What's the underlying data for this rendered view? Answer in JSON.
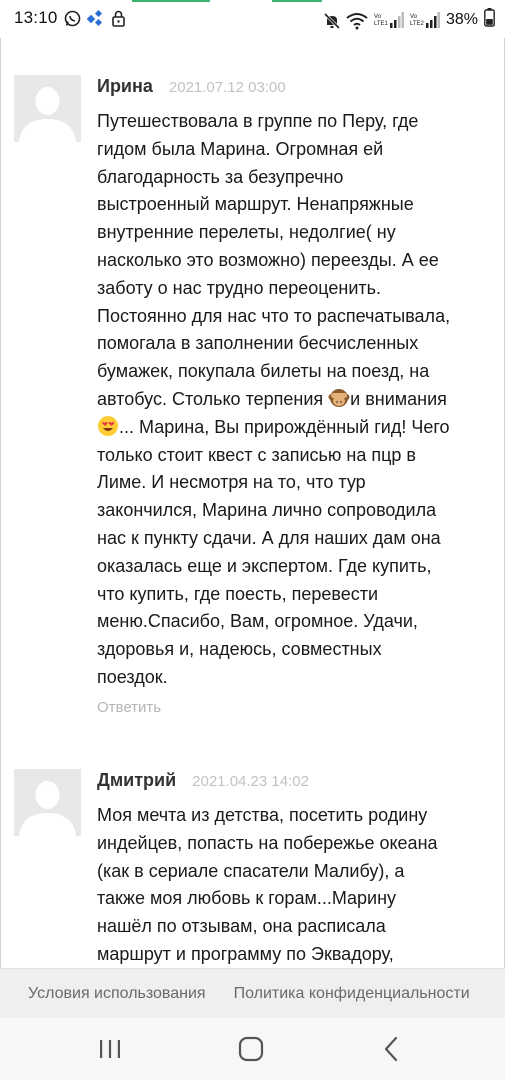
{
  "status_bar": {
    "time": "13:10",
    "battery": "38%",
    "network_1": "Vo LTE1",
    "network_2": "Vo LTE2"
  },
  "comments": [
    {
      "author": "Ирина",
      "date": "2021.07.12 03:00",
      "text_part1": "Путешествовала в группе по Перу, где\nгидом была Марина. Огромная ей\nблагодарность за безупречно\nвыстроенный маршрут. Ненапряжные\nвнутренние перелеты, недолгие( ну\nнасколько это возможно) переезды. А ее\nзаботу о нас трудно переоценить.\nПостоянно для нас что то распечатывала,\nпомогала в заполнении бесчисленных\nбумажек, покупала билеты на поезд, на\nавтобус. Столько терпения ",
      "text_part2": "и внимания\n",
      "text_part3": "... Марина, Вы прирождённый гид! Чего\nтолько стоит квест с записью на пцр в\nЛиме. И несмотря на то, что тур\nзакончился, Марина лично сопроводила\nнас к пункту сдачи. А для наших дам она\nоказалась еще и экспертом. Где купить,\nчто купить, где поесть, перевести\nменю.Спасибо, Вам, огромное. Удачи,\nздоровья и, надеюсь, совместных\nпоездок.",
      "reply_label": "Ответить"
    },
    {
      "author": "Дмитрий",
      "date": "2021.04.23 14:02",
      "text": "Моя мечта из детства, посетить родину\nиндейцев, попасть на побережье океана\n(как в сериале спасатели Малибу), а\nтакже моя любовь к горам...Марину\nнашёл по отзывам, она расписала\nмаршрут и программу по Эквадору,"
    }
  ],
  "footer": {
    "terms": "Условия использования",
    "privacy": "Политика конфиденциальности"
  },
  "icons": {
    "whatsapp": "whatsapp-icon",
    "app": "app-icon",
    "lock": "lock-icon",
    "mute": "mute-icon",
    "wifi": "wifi-icon",
    "signal": "signal-icon",
    "battery": "battery-icon",
    "emoji_1": "see-no-evil-monkey-emoji",
    "emoji_2": "heart-eyes-emoji",
    "nav_recent": "recent-apps-icon",
    "nav_home": "home-icon",
    "nav_back": "back-icon"
  }
}
